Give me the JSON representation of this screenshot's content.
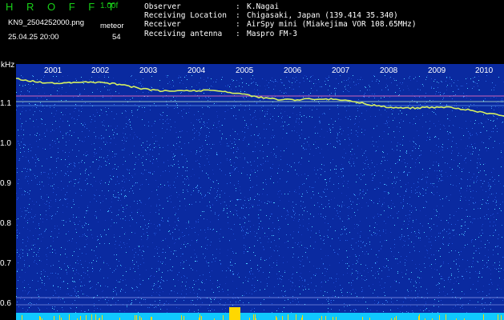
{
  "app": {
    "title": "H R O F F T",
    "version": "1.00f"
  },
  "file": {
    "name": "KN9_2504252000.png",
    "timestamp": "25.04.25 20:00"
  },
  "meteor": {
    "label": "meteor",
    "count": "54"
  },
  "info": [
    {
      "label": "Observer",
      "sep": ":",
      "value": "K.Nagai"
    },
    {
      "label": "Receiving Location",
      "sep": ":",
      "value": "Chigasaki, Japan (139.414 35.340)"
    },
    {
      "label": "Receiver",
      "sep": ":",
      "value": "AirSpy mini (Miakejima VOR 108.65MHz)"
    },
    {
      "label": "Receiving antenna",
      "sep": ":",
      "value": "Maspro FM-3"
    }
  ],
  "freq_axis": {
    "unit": "kHz",
    "ticks": [
      "1.1",
      "1.0",
      "0.9",
      "0.8",
      "0.7",
      "0.6"
    ]
  },
  "time_axis": {
    "labels": [
      "2001",
      "2002",
      "2003",
      "2004",
      "2005",
      "2006",
      "2007",
      "2008",
      "2009",
      "2010"
    ]
  },
  "colors": {
    "background": "#0a2aa0",
    "noise_bright": "#4fd0ff",
    "signal": "#d6f060",
    "baseline": "#10c8ff",
    "meteor_marker": "#ffd800"
  }
}
